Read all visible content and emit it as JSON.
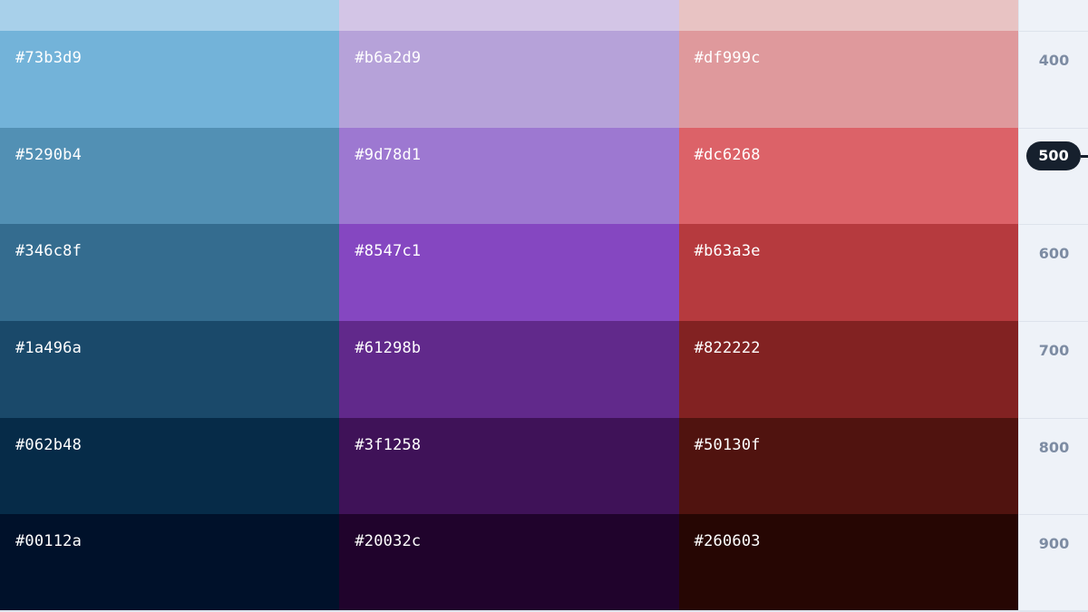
{
  "columns": [
    {
      "name": "blue",
      "top_color": "#a8d0ea",
      "swatches": [
        {
          "hex": "#73b3d9",
          "color": "#73b3d9",
          "text_color": "#ffffff"
        },
        {
          "hex": "#5290b4",
          "color": "#5290b4",
          "text_color": "#ffffff"
        },
        {
          "hex": "#346c8f",
          "color": "#346c8f",
          "text_color": "#ffffff"
        },
        {
          "hex": "#1a496a",
          "color": "#1a496a",
          "text_color": "#ffffff"
        },
        {
          "hex": "#062b48",
          "color": "#062b48",
          "text_color": "#ffffff"
        },
        {
          "hex": "#00112a",
          "color": "#00112a",
          "text_color": "#ffffff"
        }
      ]
    },
    {
      "name": "purple",
      "top_color": "#d3c5e6",
      "swatches": [
        {
          "hex": "#b6a2d9",
          "color": "#b6a2d9",
          "text_color": "#ffffff"
        },
        {
          "hex": "#9d78d1",
          "color": "#9d78d1",
          "text_color": "#ffffff"
        },
        {
          "hex": "#8547c1",
          "color": "#8547c1",
          "text_color": "#ffffff"
        },
        {
          "hex": "#61298b",
          "color": "#61298b",
          "text_color": "#ffffff"
        },
        {
          "hex": "#3f1258",
          "color": "#3f1258",
          "text_color": "#ffffff"
        },
        {
          "hex": "#20032c",
          "color": "#20032c",
          "text_color": "#ffffff"
        }
      ]
    },
    {
      "name": "red",
      "top_color": "#e8c3c3",
      "swatches": [
        {
          "hex": "#df999c",
          "color": "#df999c",
          "text_color": "#ffffff"
        },
        {
          "hex": "#dc6268",
          "color": "#dc6268",
          "text_color": "#ffffff"
        },
        {
          "hex": "#b63a3e",
          "color": "#b63a3e",
          "text_color": "#ffffff"
        },
        {
          "hex": "#822222",
          "color": "#822222",
          "text_color": "#ffffff"
        },
        {
          "hex": "#50130f",
          "color": "#50130f",
          "text_color": "#ffffff"
        },
        {
          "hex": "#260603",
          "color": "#260603",
          "text_color": "#ffffff"
        }
      ]
    }
  ],
  "scale": {
    "labels": [
      "400",
      "500",
      "600",
      "700",
      "800",
      "900"
    ],
    "active_label": "500",
    "active_bg": "#16202d",
    "label_color": "#7d8ca3"
  }
}
